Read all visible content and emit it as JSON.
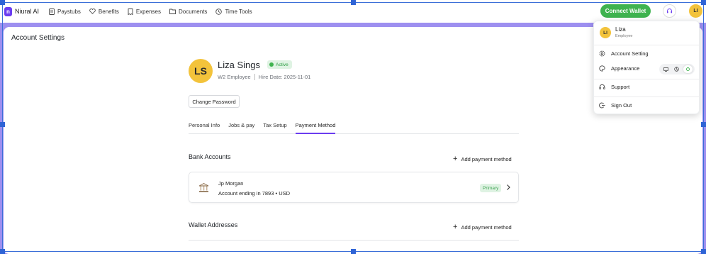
{
  "app": {
    "name": "Niural AI",
    "logo_letter": "n"
  },
  "nav": {
    "items": [
      {
        "label": "Paystubs",
        "icon": "document-icon"
      },
      {
        "label": "Benefits",
        "icon": "heart-icon"
      },
      {
        "label": "Expenses",
        "icon": "receipt-icon"
      },
      {
        "label": "Documents",
        "icon": "folder-icon"
      },
      {
        "label": "Time Tools",
        "icon": "clock-icon"
      }
    ],
    "connect_wallet": "Connect Wallet",
    "avatar_initials": "LI"
  },
  "page": {
    "title": "Account Settings"
  },
  "profile": {
    "initials": "LS",
    "name": "Liza Sings",
    "status": "Active",
    "employee_type": "W2 Employee",
    "hire_date": "Hire Date: 2025-11-01",
    "change_password": "Change Password"
  },
  "tabs": [
    {
      "label": "Personal Info",
      "active": false
    },
    {
      "label": "Jobs & pay",
      "active": false
    },
    {
      "label": "Tax Setup",
      "active": false
    },
    {
      "label": "Payment Method",
      "active": true
    }
  ],
  "bank_accounts": {
    "title": "Bank Accounts",
    "add_label": "Add payment method",
    "items": [
      {
        "bank": "Jp Morgan",
        "account": "Account ending in 7893",
        "currency": "• USD",
        "badge": "Primary"
      }
    ]
  },
  "wallet_addresses": {
    "title": "Wallet Addresses",
    "add_label": "Add payment method"
  },
  "menu": {
    "initials": "LI",
    "name": "Liza",
    "role": "Employee",
    "items": [
      {
        "label": "Account Setting",
        "icon": "gear-icon"
      },
      {
        "label": "Appearance",
        "icon": "palette-icon"
      },
      {
        "label": "Support",
        "icon": "headset-icon"
      },
      {
        "label": "Sign Out",
        "icon": "sign-out-icon"
      }
    ],
    "theme_options": [
      "monitor-icon",
      "moon-icon",
      "sun-icon"
    ],
    "theme_selected": "sun-icon"
  },
  "colors": {
    "brand": "#6b3df0",
    "connect_wallet": "#3fb34f",
    "band": "#9d8ff0",
    "avatar": "#f3c33b",
    "status_green": "#2e9e44"
  }
}
